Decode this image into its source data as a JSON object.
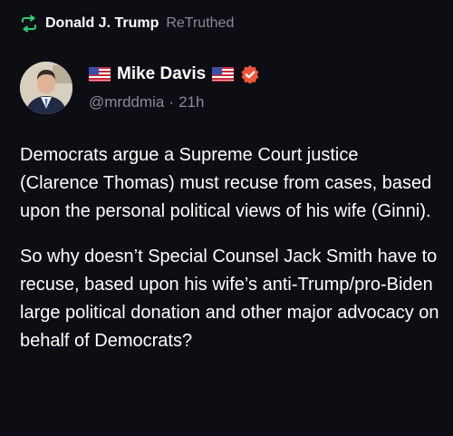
{
  "retruth": {
    "icon": "retruth-icon",
    "user": "Donald J. Trump",
    "label": "ReTruthed"
  },
  "author": {
    "display_name": "Mike Davis",
    "handle": "@mrddmia",
    "time_ago": "21h",
    "flag_icon": "us-flag-icon",
    "verified_icon": "verified-badge-icon",
    "verified_color": "#f0553a"
  },
  "post": {
    "paragraphs": [
      "Democrats argue a Supreme Court justice (Clarence Thomas) must recuse from cases, based upon the personal political views of his wife (Ginni).",
      "So why doesn’t Special Counsel Jack Smith have to recuse, based upon his wife’s anti-Trump/pro-Biden large political donation and other major advocacy on behalf of Democrats?"
    ]
  },
  "colors": {
    "background": "#0d0d14",
    "accent_green": "#2ecc71",
    "muted_text": "#8a8a99"
  }
}
